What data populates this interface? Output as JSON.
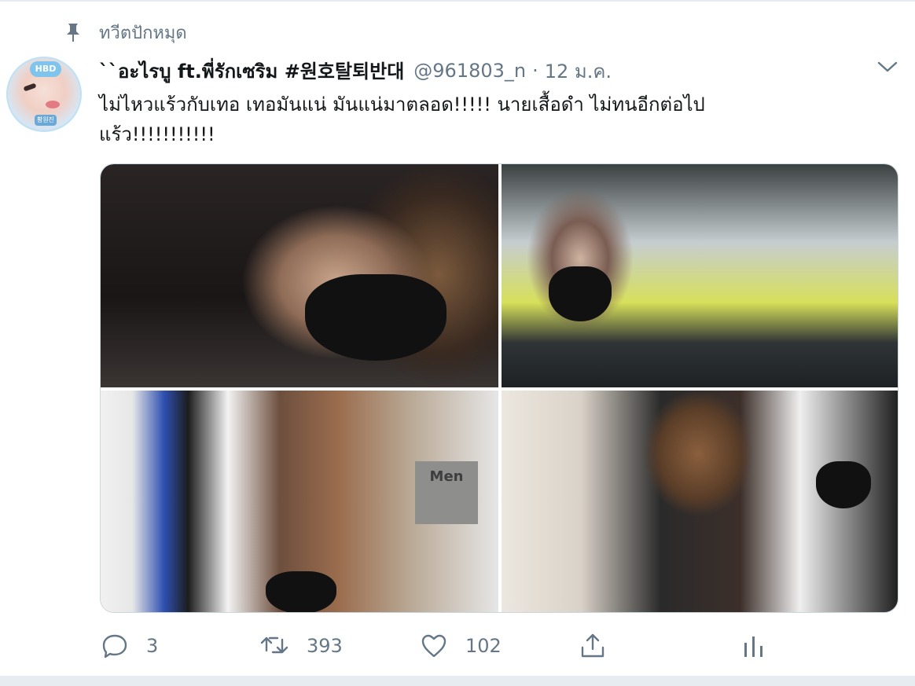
{
  "pinned": {
    "label": "ทวีตปักหมุด",
    "icon": "pin-icon"
  },
  "tweet": {
    "display_name": "``อะไรบู ft.พี่รักเซริม #원호탈퇴반대",
    "handle": "@961803_n",
    "separator": "·",
    "date": "12 ม.ค.",
    "text_line1": "ไม่ไหวแร้วกับเทอ เทอมันแน่ มันแน่มาตลอด!!!!! นายเสื้อดำ ไม่ทนอีกต่อไป",
    "text_line2": "แร้ว!!!!!!!!!!!",
    "avatar": {
      "badge_top": "HBD",
      "badge_bottom": "황원진"
    },
    "media": {
      "photo3_sign": "Men"
    }
  },
  "actions": {
    "reply_count": "3",
    "retweet_count": "393",
    "like_count": "102"
  },
  "colors": {
    "secondary_text": "#657786",
    "primary_text": "#14171a",
    "border": "#e6ecf0"
  }
}
